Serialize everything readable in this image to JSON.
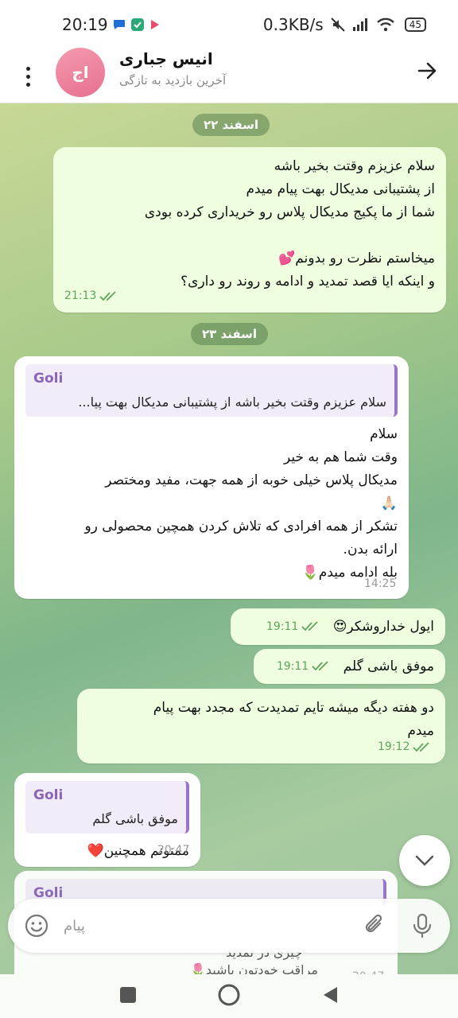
{
  "status_bar": {
    "time": "20:19",
    "net_speed": "0.3KB/s",
    "battery": "45"
  },
  "header": {
    "avatar_initials": "اج",
    "contact_name": "انیس جباری",
    "last_seen": "آخرین بازدید به تازگی"
  },
  "dates": {
    "first": "۲۲ اسفند",
    "second": "۲۳ اسفند"
  },
  "messages": [
    {
      "direction": "out",
      "text": "سلام عزیزم وقتت بخیر باشه\nاز پشتیبانی مدیکال بهت پیام میدم\nشما از ما پکیج مدیکال پلاس رو خریداری کرده بودی\n\nمیخاستم نظرت رو بدونم💕\nو اینکه ایا قصد تمدید و ادامه و روند رو داری؟",
      "time": "21:13"
    },
    {
      "direction": "in",
      "reply_name": "Goli",
      "reply_text": "سلام عزیزم وقتت بخیر باشه از پشتیبانی مدیکال بهت پیا...",
      "text": "سلام\nوقت شما هم به خیر\nمدیکال پلاس خیلی خوبه از همه جهت، مفید ومختصر\n🙏🏻\nتشکر از همه افرادی که تلاش کردن همچین محصولی رو\nارائه بدن.\nبله ادامه میدم🌷",
      "time": "14:25"
    },
    {
      "direction": "out",
      "text": "ایول خداروشکر😍",
      "time": "19:11"
    },
    {
      "direction": "out",
      "text": "موفق باشی گلم",
      "time": "19:11"
    },
    {
      "direction": "out",
      "text": "دو هفته دیگه میشه تایم تمدیدت که مجدد بهت پیام\nمیدم",
      "time": "19:12"
    },
    {
      "direction": "in",
      "reply_name": "Goli",
      "reply_text": "موفق باشی گلم",
      "text": "ممنونم همچنین❤️",
      "time": "20:47"
    },
    {
      "direction": "in",
      "reply_name": "Goli",
      "partial_line_1": "چیزی در تمدید",
      "partial_line_2": "مراقب خودتون باشید🌷",
      "partial_time": "20:47"
    }
  ],
  "input": {
    "placeholder": "پیام"
  },
  "colors": {
    "accent_green": "#5ea45c",
    "outgoing_bubble": "#eefedf",
    "reply_purple": "#9a74c6"
  },
  "icons": {
    "menu": "more-vertical-icon",
    "back": "arrow-right-icon",
    "scroll": "chevron-down-icon",
    "emoji": "smiley-icon",
    "attach": "paperclip-icon",
    "mic": "microphone-icon"
  }
}
